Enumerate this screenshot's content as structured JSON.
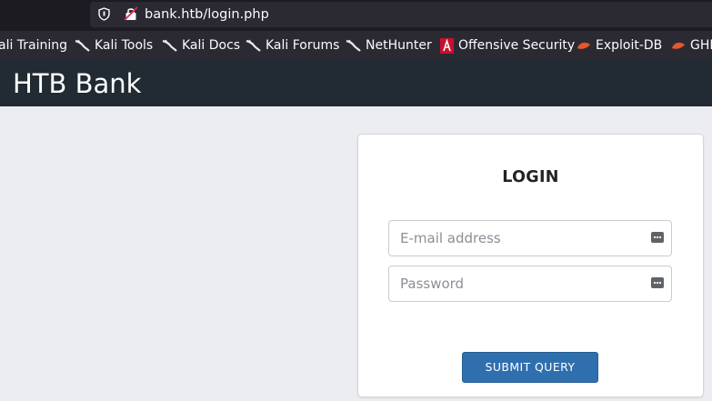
{
  "browser": {
    "url": "bank.htb/login.php",
    "bookmarks": [
      {
        "label": "ali Training",
        "icon": "kali-dragon-icon"
      },
      {
        "label": "Kali Tools",
        "icon": "kali-dragon-icon"
      },
      {
        "label": "Kali Docs",
        "icon": "kali-dragon-icon"
      },
      {
        "label": "Kali Forums",
        "icon": "kali-dragon-icon"
      },
      {
        "label": "NetHunter",
        "icon": "kali-dragon-icon"
      },
      {
        "label": "Offensive Security",
        "icon": "offsec-icon"
      },
      {
        "label": "Exploit-DB",
        "icon": "exploitdb-icon"
      },
      {
        "label": "GHI",
        "icon": "exploitdb-icon"
      }
    ]
  },
  "site": {
    "title": "HTB Bank"
  },
  "login": {
    "heading": "LOGIN",
    "email_placeholder": "E-mail address",
    "password_placeholder": "Password",
    "submit_label": "SUBMIT QUERY"
  },
  "colors": {
    "header_bg": "#222a33",
    "page_bg": "#ecedf0",
    "button_bg": "#2f6fae"
  }
}
